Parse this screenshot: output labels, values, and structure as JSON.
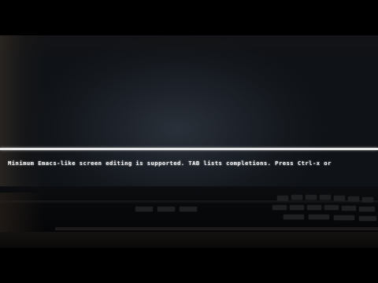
{
  "terminal": {
    "status_message": "Minimum Emacs-like screen editing is supported. TAB lists completions. Press Ctrl-x or"
  }
}
